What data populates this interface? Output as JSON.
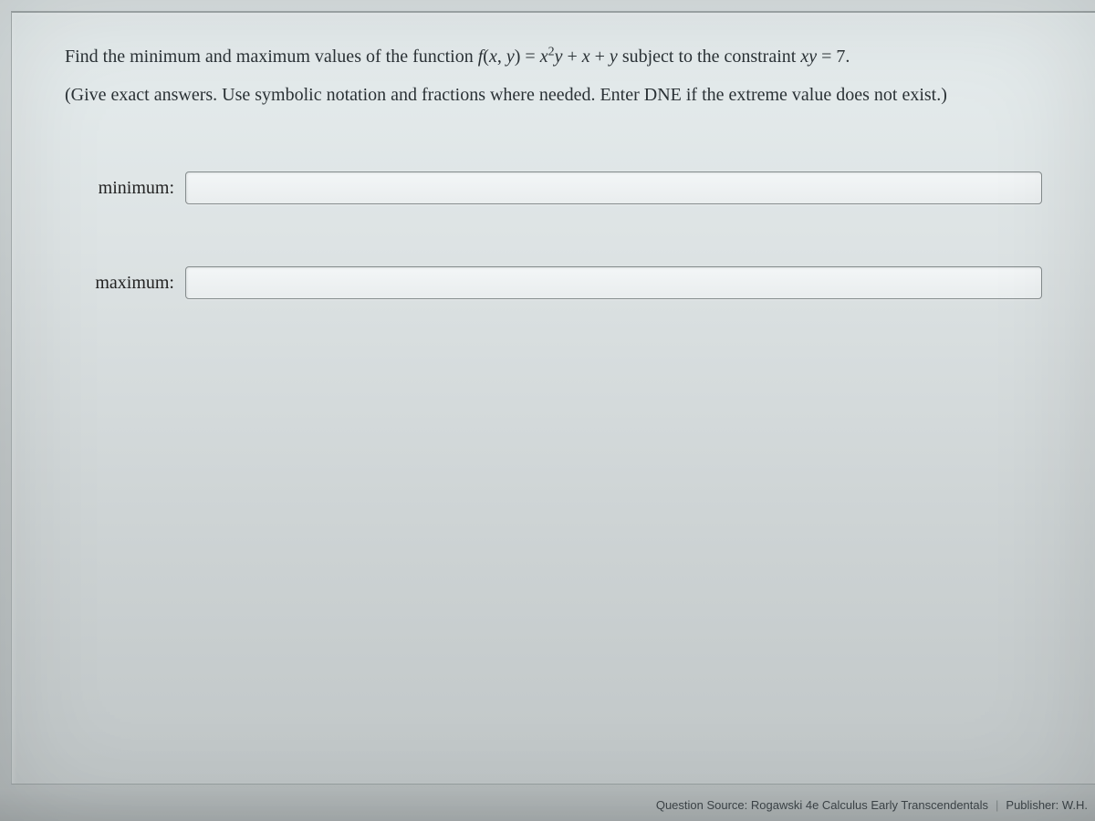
{
  "question": {
    "prefix": "Find the minimum and maximum values of the function ",
    "func_symbol": "f",
    "func_args_open": "(",
    "func_arg_x": "x",
    "func_args_sep": ", ",
    "func_arg_y": "y",
    "func_args_close": ") = ",
    "expr_x": "x",
    "expr_exp": "2",
    "expr_y1": "y",
    "expr_plus1": " + ",
    "expr_x2": "x",
    "expr_plus2": " + ",
    "expr_y2": "y",
    "subject_text": " subject to the constraint ",
    "constraint_xy": "xy",
    "constraint_eq": " = 7."
  },
  "instructions": "(Give exact answers. Use symbolic notation and fractions where needed. Enter DNE if the extreme value does not exist.)",
  "labels": {
    "minimum": "minimum:",
    "maximum": "maximum:"
  },
  "inputs": {
    "minimum_value": "",
    "minimum_placeholder": "",
    "maximum_value": "",
    "maximum_placeholder": ""
  },
  "footer": {
    "source": "Question Source: Rogawski 4e Calculus Early Transcendentals",
    "divider": "|",
    "publisher": "Publisher: W.H."
  }
}
